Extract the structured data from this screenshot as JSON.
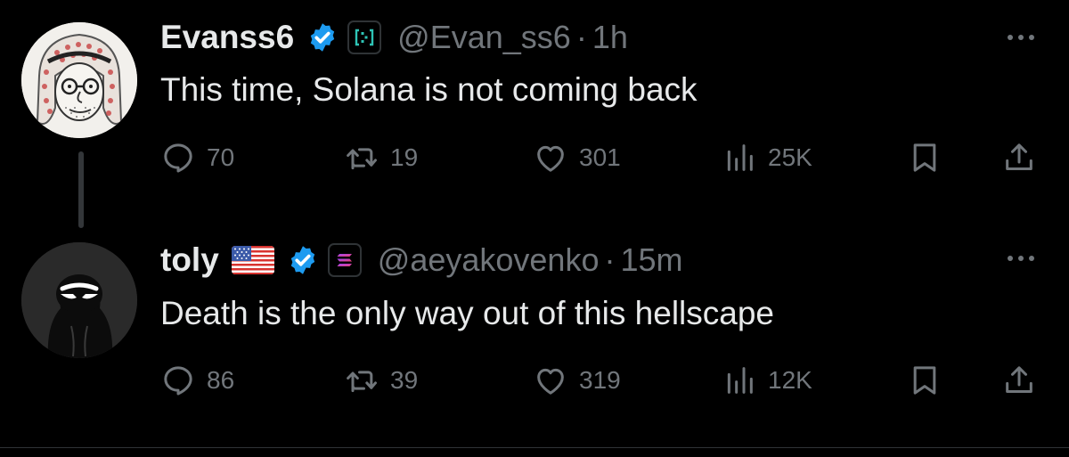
{
  "tweets": [
    {
      "display_name": "Evanss6",
      "handle": "@Evan_ss6",
      "separator": "·",
      "time": "1h",
      "text": "This time, Solana is not coming back",
      "stats": {
        "replies": "70",
        "reposts": "19",
        "likes": "301",
        "views": "25K"
      },
      "icons": {
        "verified": "verified-badge-icon",
        "affiliation": "affiliation-badge-icon"
      }
    },
    {
      "display_name": "toly",
      "handle": "@aeyakovenko",
      "separator": "·",
      "time": "15m",
      "text": "Death is the only way out of this hellscape",
      "stats": {
        "replies": "86",
        "reposts": "39",
        "likes": "319",
        "views": "12K"
      },
      "icons": {
        "flag": "us-flag-icon",
        "verified": "verified-badge-icon",
        "affiliation": "solana-logo-icon"
      }
    }
  ],
  "colors": {
    "background": "#000000",
    "primary_text": "#e7e9ea",
    "secondary_text": "#71767b",
    "verified_blue": "#1d9bf0",
    "thread_line": "#333639",
    "divider": "#2f3336"
  }
}
